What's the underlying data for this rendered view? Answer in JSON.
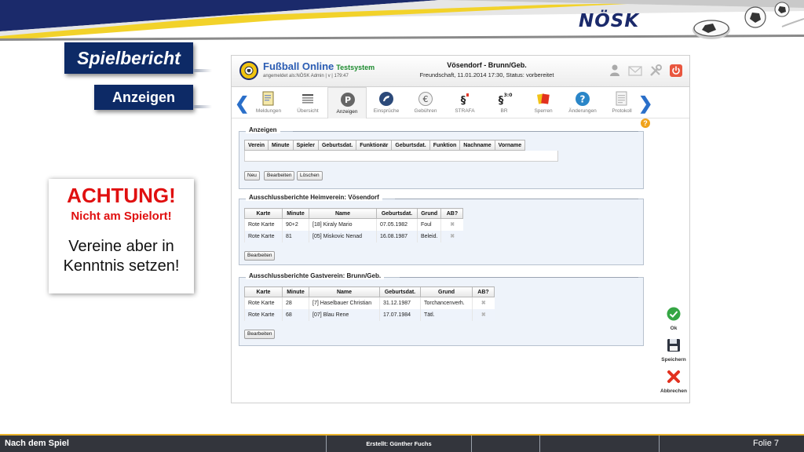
{
  "slide": {
    "logo": "NÖSK",
    "title": "Spielbericht",
    "subtitle": "Anzeigen",
    "warning": {
      "heading": "ACHTUNG!",
      "line2": "Nicht am Spielort!",
      "line3": "Vereine aber in",
      "line4": "Kenntnis setzen!"
    }
  },
  "app": {
    "name": "Fußball Online",
    "env_badge": "Testsystem",
    "user_info": "angemeldet als:NÖSK Admin | v | 179:47",
    "match_title": "Vösendorf - Brunn/Geb.",
    "match_subtitle": "Freundschaft, 11.01.2014 17:30, Status: vorbereitet",
    "header_icons": [
      "user-icon",
      "mail-icon",
      "tools-icon",
      "power-icon"
    ]
  },
  "nav": {
    "items": [
      {
        "label": "Meldungen",
        "icon": "document-icon"
      },
      {
        "label": "Übersicht",
        "icon": "list-icon"
      },
      {
        "label": "Anzeigen",
        "icon": "parking-sign-icon",
        "active": true
      },
      {
        "label": "Einsprüche",
        "icon": "appeal-icon"
      },
      {
        "label": "Gebühren",
        "icon": "euro-icon"
      },
      {
        "label": "STRAFA",
        "icon": "paragraph-icon"
      },
      {
        "label": "BR",
        "icon": "paragraph-ratio-icon",
        "icon_text": "§",
        "sup": "3:0"
      },
      {
        "label": "Sperren",
        "icon": "cards-icon"
      },
      {
        "label": "Änderungen",
        "icon": "help-circle-icon"
      },
      {
        "label": "Protokoll",
        "icon": "protocol-icon"
      }
    ]
  },
  "anzeigen": {
    "legend": "Anzeigen",
    "columns": [
      "Verein",
      "Minute",
      "Spieler",
      "Geburtsdat.",
      "Funktionär",
      "Geburtsdat.",
      "Funktion",
      "Nachname",
      "Vorname"
    ],
    "buttons": {
      "new": "Neu",
      "edit": "Bearbeiten",
      "delete": "Löschen"
    }
  },
  "heim": {
    "legend": "Ausschlussberichte Heimverein: Vösendorf",
    "columns": [
      "Karte",
      "Minute",
      "Name",
      "Geburtsdat.",
      "Grund",
      "AB?"
    ],
    "rows": [
      {
        "karte": "Rote Karte",
        "minute": "90+2",
        "name": "[18] Kiraly Mario",
        "geb": "07.05.1982",
        "grund": "Foul",
        "ab": "✖"
      },
      {
        "karte": "Rote Karte",
        "minute": "81",
        "name": "[05] Miskovic Nenad",
        "geb": "16.08.1987",
        "grund": "Beleid.",
        "ab": "✖"
      }
    ],
    "edit": "Bearbeiten"
  },
  "gast": {
    "legend": "Ausschlussberichte Gastverein: Brunn/Geb.",
    "columns": [
      "Karte",
      "Minute",
      "Name",
      "Geburtsdat.",
      "Grund",
      "AB?"
    ],
    "rows": [
      {
        "karte": "Rote Karte",
        "minute": "28",
        "name": "[7] Haselbauer Christian",
        "geb": "31.12.1987",
        "grund": "Torchancenverh.",
        "ab": "✖"
      },
      {
        "karte": "Rote Karte",
        "minute": "68",
        "name": "[07] Blau Rene",
        "geb": "17.07.1984",
        "grund": "Tätl.",
        "ab": "✖"
      }
    ],
    "edit": "Bearbeiten"
  },
  "side": {
    "ok": "Ok",
    "save": "Speichern",
    "cancel": "Abbrechen"
  },
  "footer": {
    "left": "Nach dem Spiel",
    "middle": "Erstellt: Günther Fuchs",
    "right": "Folie  7"
  },
  "colors": {
    "navy": "#0d2a66",
    "warning_red": "#e01010",
    "footer_bg": "#33353c",
    "accent_yellow": "#e9b22c"
  }
}
